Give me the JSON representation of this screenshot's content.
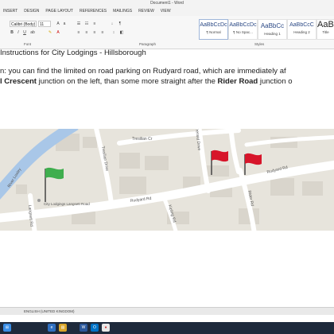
{
  "window": {
    "title": "Document1 - Word"
  },
  "ribbon": {
    "tabs": [
      "INSERT",
      "DESIGN",
      "PAGE LAYOUT",
      "REFERENCES",
      "MAILINGS",
      "REVIEW",
      "VIEW"
    ],
    "font_name": "Calibri (Body)",
    "font_size": "11",
    "group_font": "Font",
    "group_paragraph": "Paragraph",
    "group_styles": "Styles",
    "styles": [
      {
        "preview": "AaBbCcDc",
        "label": "¶ Normal"
      },
      {
        "preview": "AaBbCcDc",
        "label": "¶ No Spac..."
      },
      {
        "preview": "AaBbCc",
        "label": "Heading 1"
      },
      {
        "preview": "AaBbCcC",
        "label": "Heading 2"
      },
      {
        "preview": "AaBl",
        "label": "Title"
      }
    ]
  },
  "document": {
    "line1": "Instructions for City Lodgings - Hillsborough",
    "line2": "n: you can find the limited on road parking on Rudyard road, which are immediately af",
    "line3_bold1": "l Crescent",
    "line3_mid": " junction on the left, than some more straight after the ",
    "line3_bold2": "Rider Road",
    "line3_end": " junction o"
  },
  "map": {
    "streets": {
      "river": "River Loxley",
      "langsett": "Langsett Rd",
      "tresilian_top": "Tresilian Cr",
      "tresilian_drive": "Tresilian Drive",
      "trensid": "Trensid Drive",
      "rudyard_left": "Rudyard Rd",
      "rudyard_right": "Rudyard Rd",
      "kipling": "Kipling Rd",
      "rider": "Rider Rd"
    },
    "place": "City Lodgings Langsett Road",
    "flag_colors": {
      "start": "#3fae4e",
      "parking": "#d7152a"
    }
  },
  "statusbar": {
    "language": "ENGLISH (UNITED KINGDOM)"
  },
  "taskbar": {
    "icons": [
      "windows-icon",
      "ie-icon",
      "explorer-icon",
      "word-icon",
      "outlook-icon",
      "chrome-icon"
    ]
  }
}
